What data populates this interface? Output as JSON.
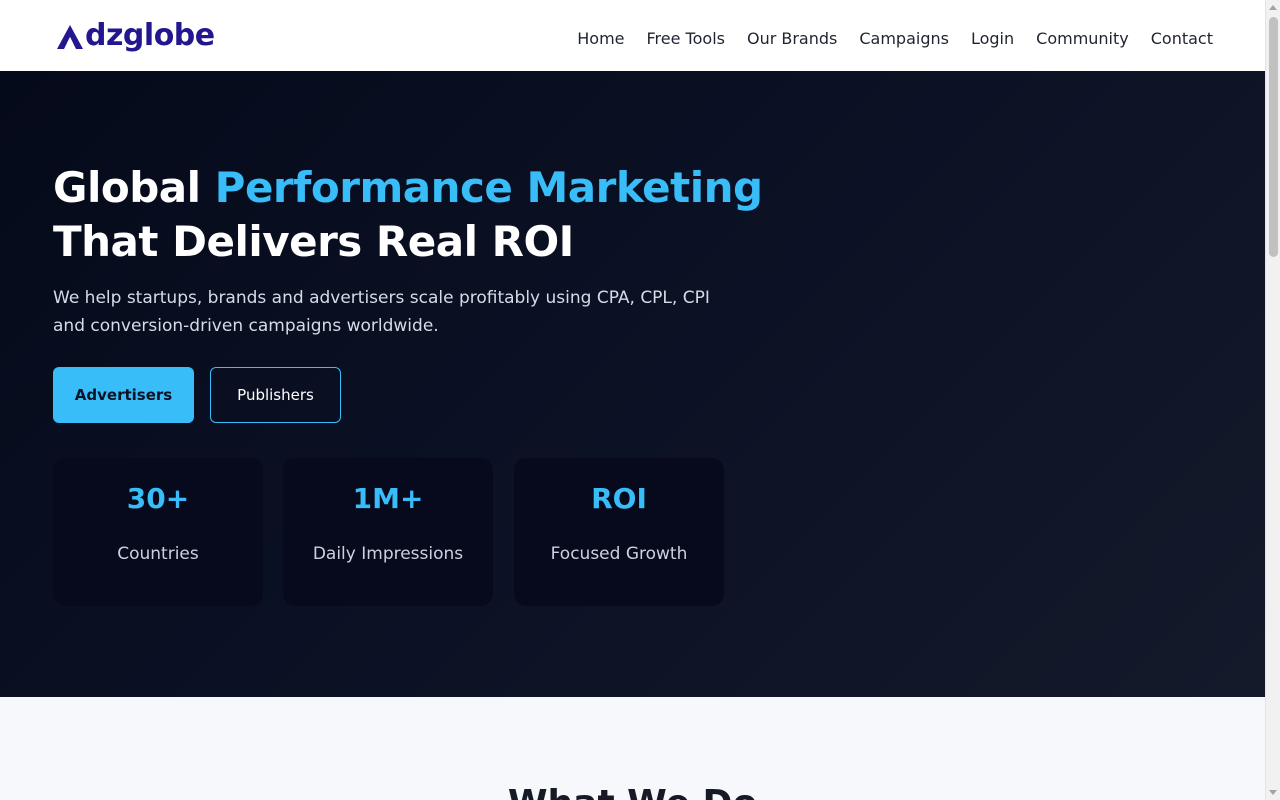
{
  "header": {
    "logo_text": "dzglobe",
    "nav": [
      {
        "label": "Home"
      },
      {
        "label": "Free Tools"
      },
      {
        "label": "Our Brands"
      },
      {
        "label": "Campaigns"
      },
      {
        "label": "Login"
      },
      {
        "label": "Community"
      },
      {
        "label": "Contact"
      }
    ]
  },
  "hero": {
    "title_part1": "Global ",
    "title_accent": "Performance Marketing",
    "title_part2": "That Delivers Real ROI",
    "subtitle": "We help startups, brands and advertisers scale profitably using CPA, CPL, CPI and conversion-driven campaigns worldwide.",
    "primary_button": "Advertisers",
    "secondary_button": "Publishers",
    "stats": [
      {
        "value": "30+",
        "label": "Countries"
      },
      {
        "value": "1M+",
        "label": "Daily Impressions"
      },
      {
        "value": "ROI",
        "label": "Focused Growth"
      }
    ]
  },
  "next_section": {
    "heading": "What We Do"
  },
  "colors": {
    "brand": "#23178f",
    "accent": "#38bdf8",
    "hero_bg": "#0b1124"
  },
  "icons": {
    "logo": "triangle-a-logo-icon"
  }
}
